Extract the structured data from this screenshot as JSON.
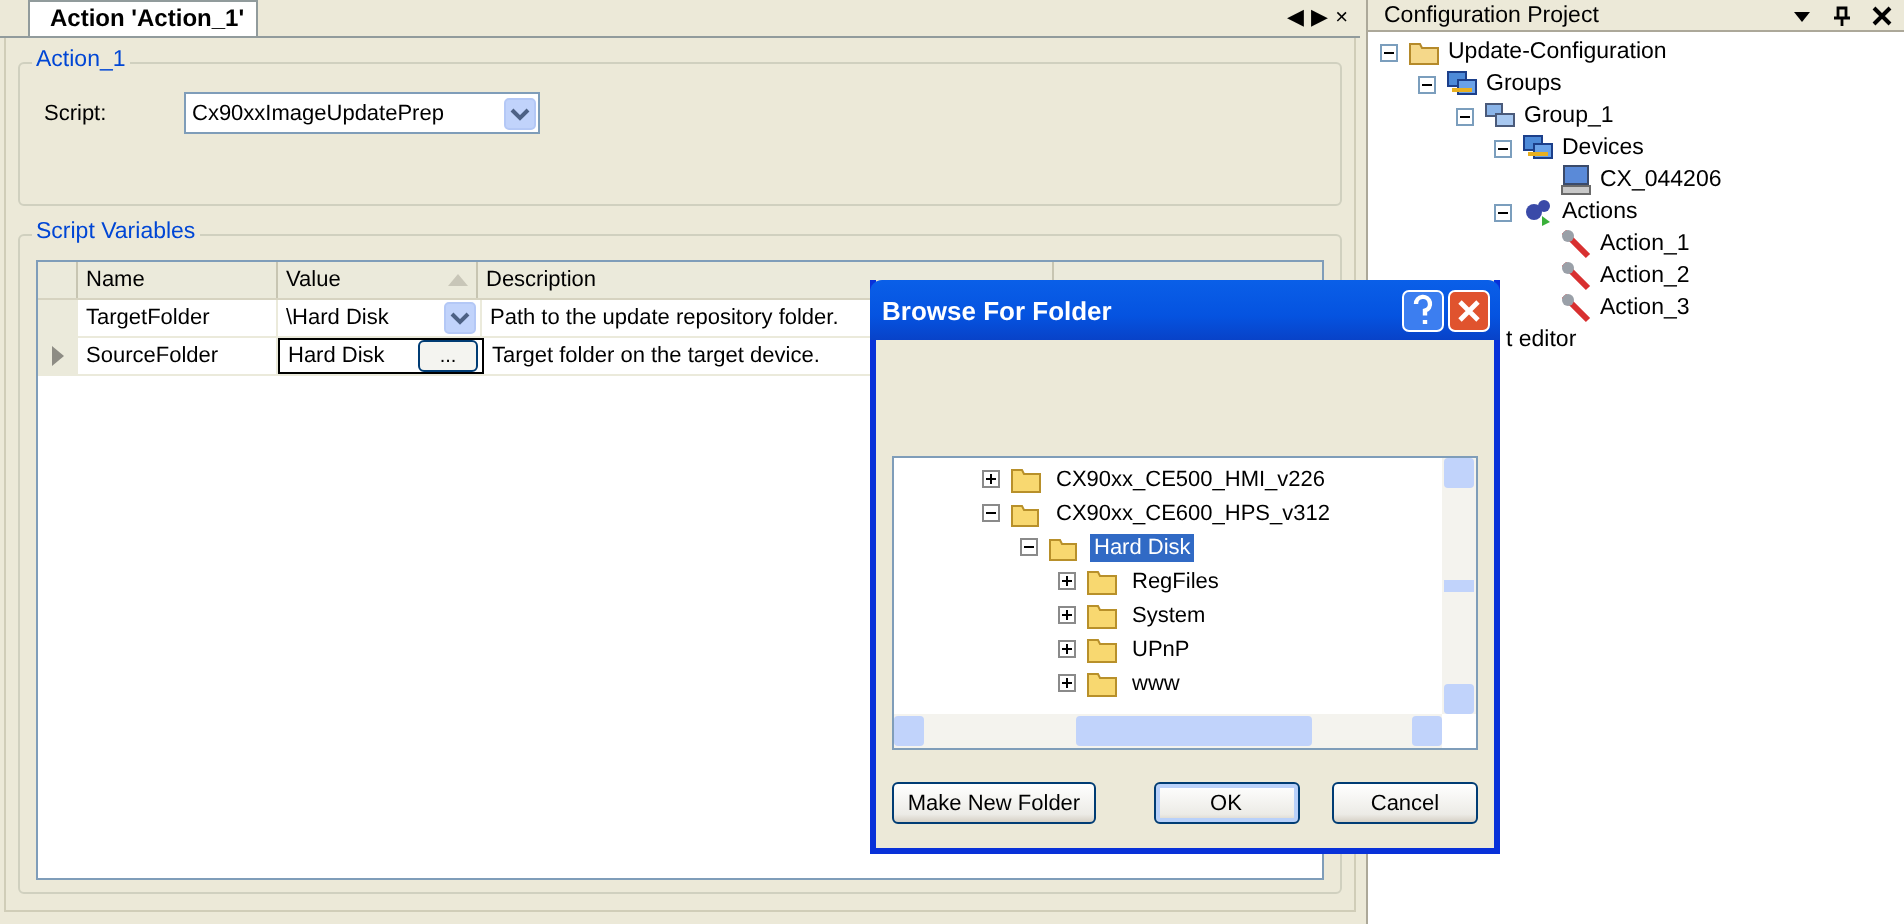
{
  "document_tab": {
    "label": "Action 'Action_1'",
    "selected": true
  },
  "document_controls": [
    "◀",
    "▶",
    "×"
  ],
  "action_group": {
    "title": "Action_1",
    "script_label": "Script:",
    "script_value": "Cx90xxImageUpdatePrep"
  },
  "variables": {
    "title": "Script Variables",
    "columns": [
      "Name",
      "Value",
      "Description"
    ],
    "rows": [
      {
        "name": "TargetFolder",
        "value": "\\Hard Disk",
        "kind": "dropdown",
        "description": "Path to the update repository folder.",
        "current": false
      },
      {
        "name": "SourceFolder",
        "value": "Hard Disk",
        "kind": "browse",
        "button_label": "...",
        "description": "Target folder on the target device.",
        "current": true
      }
    ]
  },
  "project_panel": {
    "title": "Configuration Project",
    "tree": [
      {
        "label": "Update-Configuration",
        "kind": "folder",
        "expanded": true,
        "children": [
          {
            "label": "Groups",
            "kind": "network",
            "expanded": true,
            "children": [
              {
                "label": "Group_1",
                "kind": "group",
                "expanded": true,
                "children": [
                  {
                    "label": "Devices",
                    "kind": "network",
                    "expanded": true,
                    "children": [
                      {
                        "label": "CX_044206",
                        "kind": "computer"
                      }
                    ]
                  },
                  {
                    "label": "Actions",
                    "kind": "gears",
                    "expanded": true,
                    "children": [
                      {
                        "label": "Action_1",
                        "kind": "wrench"
                      },
                      {
                        "label": "Action_2",
                        "kind": "wrench"
                      },
                      {
                        "label": "Action_3",
                        "kind": "wrench"
                      }
                    ]
                  }
                ]
              }
            ]
          }
        ]
      }
    ],
    "partial_item": "t editor"
  },
  "dialog": {
    "title": "Browse For Folder",
    "tree": [
      {
        "label": "CX90xx_CE500_HMI_v226",
        "expanded": false,
        "selected": false
      },
      {
        "label": "CX90xx_CE600_HPS_v312",
        "expanded": true,
        "selected": false,
        "children": [
          {
            "label": "Hard Disk",
            "expanded": true,
            "selected": true,
            "children": [
              {
                "label": "RegFiles",
                "expanded": false,
                "selected": false
              },
              {
                "label": "System",
                "expanded": false,
                "selected": false
              },
              {
                "label": "UPnP",
                "expanded": false,
                "selected": false
              },
              {
                "label": "www",
                "expanded": false,
                "selected": false
              }
            ]
          }
        ]
      }
    ],
    "buttons": [
      {
        "label": "Make New Folder",
        "default": false
      },
      {
        "label": "OK",
        "default": true
      },
      {
        "label": "Cancel",
        "default": false
      }
    ]
  }
}
